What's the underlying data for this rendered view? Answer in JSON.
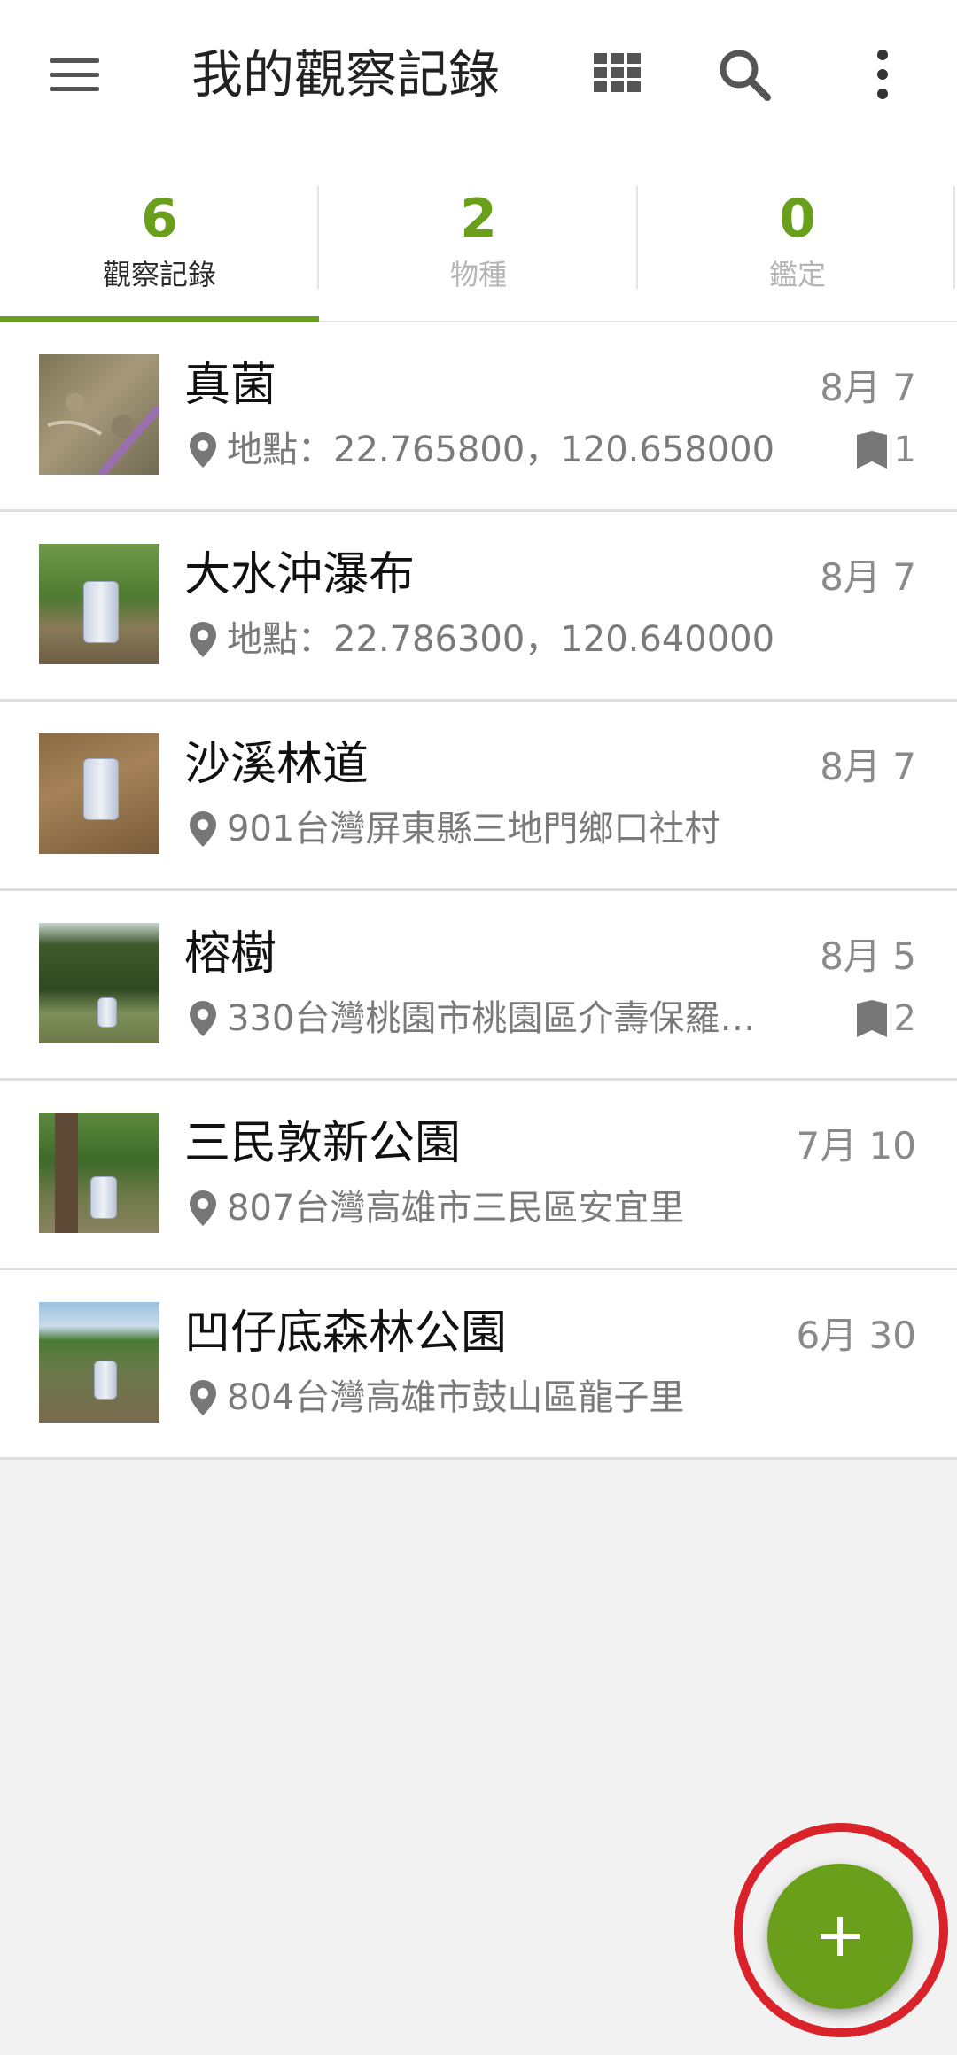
{
  "appbar": {
    "title": "我的觀察記錄",
    "icons": [
      "menu-icon",
      "grid-view-icon",
      "search-icon",
      "more-vert-icon"
    ]
  },
  "tabs": [
    {
      "count": "6",
      "label": "觀察記錄",
      "active": true
    },
    {
      "count": "2",
      "label": "物種",
      "active": false
    },
    {
      "count": "0",
      "label": "鑑定",
      "active": false
    }
  ],
  "observations": [
    {
      "name": "真菌",
      "date": "8月 7",
      "location": "地點：22.765800，120.658000",
      "identifications": "1"
    },
    {
      "name": "大水沖瀑布",
      "date": "8月 7",
      "location": "地點：22.786300，120.640000",
      "identifications": ""
    },
    {
      "name": "沙溪林道",
      "date": "8月 7",
      "location": "901台灣屏東縣三地門鄉口社村",
      "identifications": ""
    },
    {
      "name": "榕樹",
      "date": "8月 5",
      "location": "330台灣桃園市桃園區介壽保羅…",
      "identifications": "2"
    },
    {
      "name": "三民敦新公園",
      "date": "7月 10",
      "location": "807台灣高雄市三民區安宜里",
      "identifications": ""
    },
    {
      "name": "凹仔底森林公園",
      "date": "6月 30",
      "location": "804台灣高雄市鼓山區龍子里",
      "identifications": ""
    }
  ],
  "fab": {
    "icon": "plus-icon"
  },
  "colors": {
    "accent": "#6a9f1c",
    "highlight_ring": "#d9222a"
  }
}
